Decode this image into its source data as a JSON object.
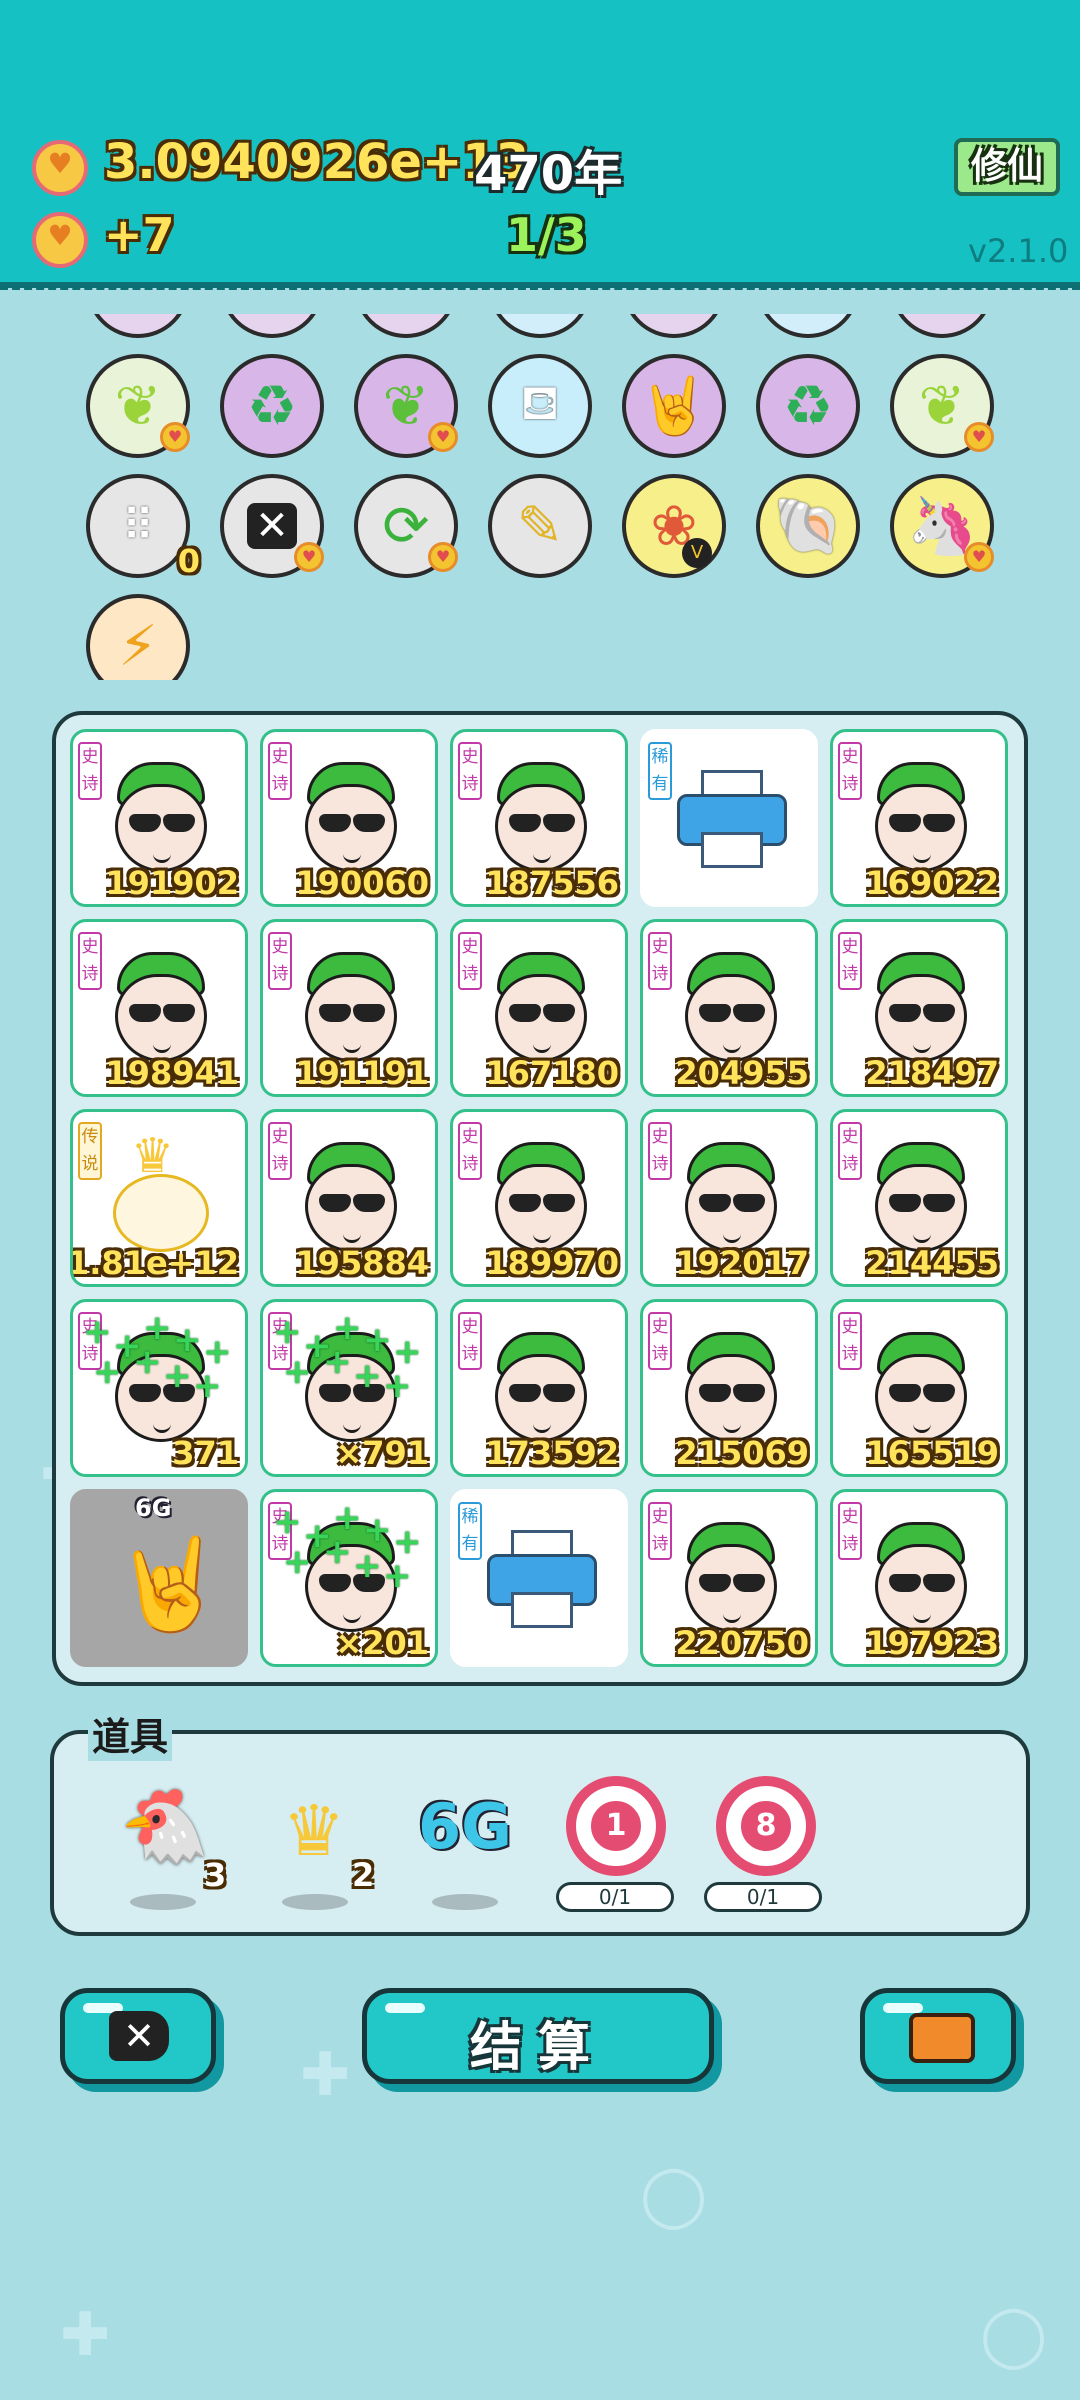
{
  "header": {
    "coins": "3.0940926e+13",
    "years": "470年",
    "income": "+7",
    "progress": "1/3",
    "cultivate_label": "修仙",
    "version": "v2.1.0"
  },
  "skills": {
    "row2": [
      "leaf-icon",
      "recycle-icon",
      "leaf-icon",
      "skirt-icon",
      "rock-hand-icon",
      "recycle-icon",
      "leaf-icon"
    ],
    "row3": [
      "egg-tray-icon",
      "delete-icon",
      "refresh-icon",
      "screwdriver-icon",
      "fruit-bowl-icon",
      "shell-icon",
      "unicorn-icon"
    ],
    "egg_tray_count": "0",
    "vip_badge": "V"
  },
  "rank_labels": {
    "epic": "史诗",
    "rare": "稀有",
    "legend": "传说"
  },
  "board": {
    "row1": [
      "191902",
      "190060",
      "187556",
      "",
      "169022"
    ],
    "row2": [
      "198941",
      "191191",
      "167180",
      "204955",
      "218497"
    ],
    "row3": [
      "1.81e+12",
      "195884",
      "189970",
      "192017",
      "214455"
    ],
    "row4": [
      "371",
      "×791",
      "173592",
      "215069",
      "165519"
    ],
    "row5": [
      "",
      "×201",
      "",
      "220750",
      "197923"
    ],
    "selected_tag": "6G"
  },
  "props": {
    "title": "道具",
    "bird_count": "3",
    "crown_count": "2",
    "signal_label": "6G",
    "target1_number": "1",
    "target1_status": "0/1",
    "target2_number": "8",
    "target2_status": "0/1"
  },
  "buttons": {
    "settle_label": "结算"
  },
  "colors": {
    "header": "#16c1c3",
    "epic": "#c13aa8",
    "rare": "#2b9ad9",
    "legend": "#e3a721",
    "number": "#ffe35a"
  }
}
